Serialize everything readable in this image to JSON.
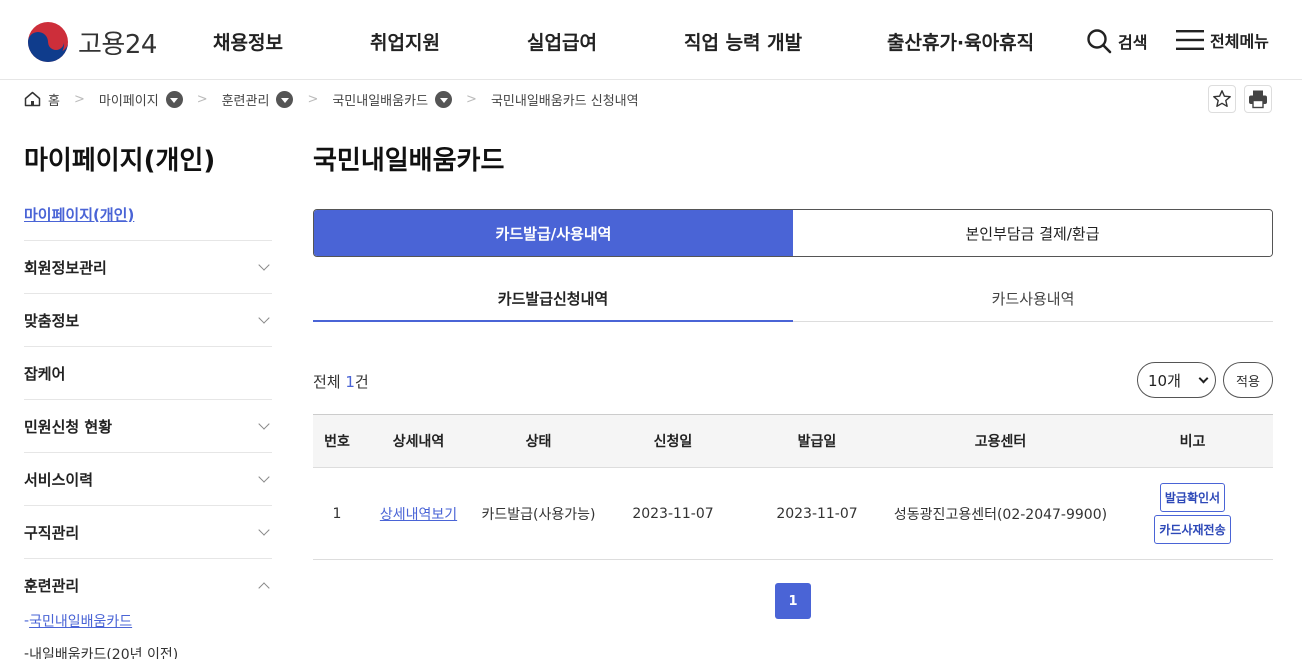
{
  "header": {
    "logo_text": "고용24",
    "nav": [
      {
        "label": "채용정보"
      },
      {
        "label": "취업지원"
      },
      {
        "label": "실업급여"
      },
      {
        "label": "직업 능력 개발"
      },
      {
        "label": "출산휴가·육아휴직"
      }
    ],
    "search_label": "검색",
    "menu_label": "전체메뉴"
  },
  "breadcrumb": {
    "home": "홈",
    "items": [
      "마이페이지",
      "훈련관리",
      "국민내일배움카드",
      "국민내일배움카드 신청내역"
    ]
  },
  "sidebar": {
    "title": "마이페이지(개인)",
    "active_link": "마이페이지(개인)",
    "items": [
      {
        "label": "회원정보관리",
        "expandable": true
      },
      {
        "label": "맞춤정보",
        "expandable": true
      },
      {
        "label": "잡케어",
        "expandable": false
      },
      {
        "label": "민원신청 현황",
        "expandable": true
      },
      {
        "label": "서비스이력",
        "expandable": true
      },
      {
        "label": "구직관리",
        "expandable": true
      },
      {
        "label": "훈련관리",
        "expandable": true,
        "expanded": true
      }
    ],
    "sub_items": [
      {
        "prefix": "- ",
        "label": "국민내일배움카드",
        "active": true
      },
      {
        "prefix": "- ",
        "label": "내일배움카드(20년 이전)",
        "active": false
      }
    ]
  },
  "main": {
    "title": "국민내일배움카드",
    "tabs1": [
      {
        "label": "카드발급/사용내역",
        "active": true
      },
      {
        "label": "본인부담금 결제/환급",
        "active": false
      }
    ],
    "tabs2": [
      {
        "label": "카드발급신청내역",
        "active": true
      },
      {
        "label": "카드사용내역",
        "active": false
      }
    ],
    "total_prefix": "전체 ",
    "total_count": "1",
    "total_suffix": "건",
    "page_size": "10개",
    "apply_label": "적용",
    "table": {
      "headers": [
        "번호",
        "상세내역",
        "상태",
        "신청일",
        "발급일",
        "고용센터",
        "비고"
      ],
      "rows": [
        {
          "no": "1",
          "detail": "상세내역보기",
          "status": "카드발급(사용가능)",
          "apply_date": "2023-11-07",
          "issue_date": "2023-11-07",
          "center": "성동광진고용센터(02-2047-9900)",
          "btn1": "발급확인서",
          "btn2": "카드사재전송"
        }
      ]
    },
    "current_page": "1"
  },
  "colors": {
    "accent": "#4a64d6",
    "logo_red": "#cd2e3a",
    "logo_blue": "#0f64cd"
  }
}
